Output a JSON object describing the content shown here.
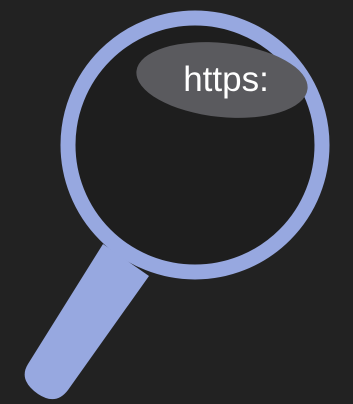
{
  "icon": "magnifying-glass-icon",
  "url_badge": {
    "text": "https:"
  },
  "colors": {
    "background": "#222222",
    "lens_frame": "#97a8e0",
    "lens_glass": "#1e1e1e",
    "handle": "#97a8e0",
    "badge_fill": "#5a5a5e",
    "badge_text": "#ffffff"
  }
}
